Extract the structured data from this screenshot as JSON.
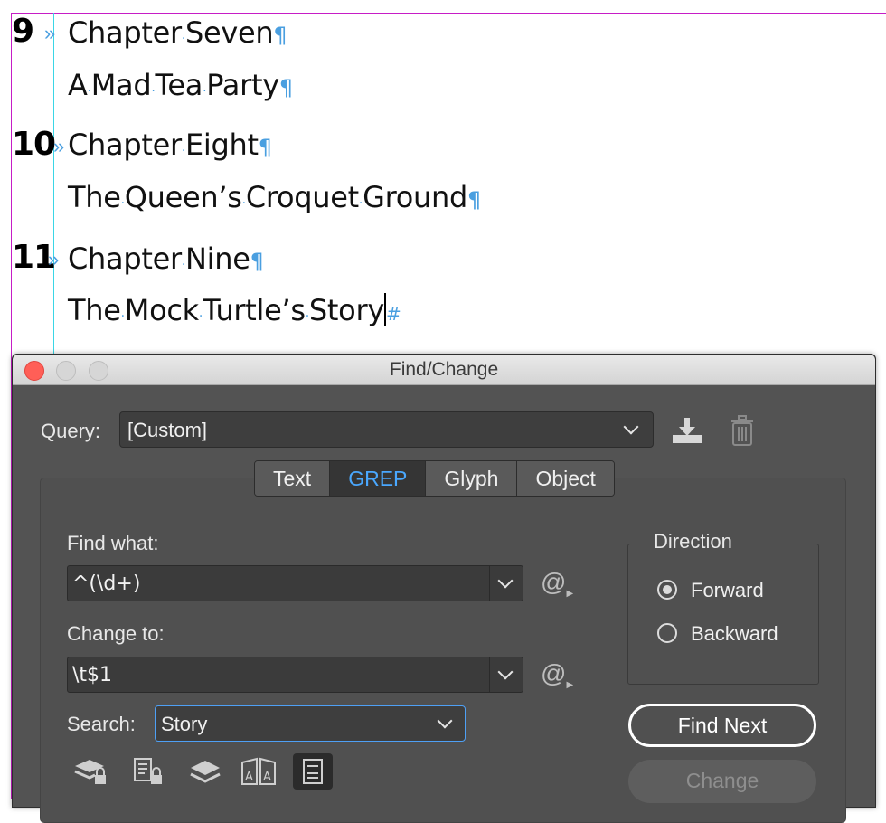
{
  "document": {
    "entries": [
      {
        "number": "9",
        "chapter": [
          "Chapter",
          "Seven"
        ],
        "subtitle": [
          "A",
          "Mad",
          "Tea",
          "Party"
        ]
      },
      {
        "number": "10",
        "chapter": [
          "Chapter",
          "Eight"
        ],
        "subtitle": [
          "The",
          "Queen’s",
          "Croquet",
          "Ground"
        ]
      },
      {
        "number": "11",
        "chapter": [
          "Chapter",
          "Nine"
        ],
        "subtitle": [
          "The",
          "Mock",
          "Turtle’s",
          "Story"
        ]
      }
    ],
    "tab_marker": "»",
    "space_marker": "·",
    "pilcrow": "¶",
    "end_of_story": "#"
  },
  "dialog": {
    "title": "Find/Change",
    "query_label": "Query:",
    "query_value": "[Custom]",
    "tabs": [
      {
        "label": "Text",
        "active": false
      },
      {
        "label": "GREP",
        "active": true
      },
      {
        "label": "Glyph",
        "active": false
      },
      {
        "label": "Object",
        "active": false
      }
    ],
    "find_label": "Find what:",
    "find_value": "^(\\d+)",
    "change_label": "Change to:",
    "change_value": "\\t$1",
    "special_char_symbol": "@",
    "search_label": "Search:",
    "search_value": "Story",
    "direction_label": "Direction",
    "direction_options": [
      {
        "label": "Forward",
        "selected": true
      },
      {
        "label": "Backward",
        "selected": false
      }
    ],
    "find_next_label": "Find Next",
    "change_button_label": "Change",
    "colors": {
      "accent": "#4aa8ff",
      "background": "#535353",
      "guide": "#c61dc6",
      "invisible_chars": "#4a9fe0"
    },
    "option_icons": [
      "locked-layers-icon",
      "locked-stories-icon",
      "hidden-layers-icon",
      "master-pages-icon",
      "footnotes-icon"
    ]
  }
}
